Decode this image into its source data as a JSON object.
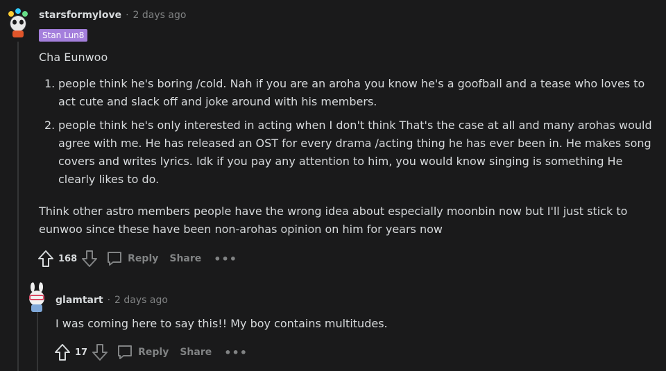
{
  "comments": [
    {
      "username": "starsformylove",
      "time": "2 days ago",
      "flair": "Stan Lun8",
      "paragraph1": "Cha Eunwoo",
      "list": [
        {
          "num": "1.",
          "text": "people think he's boring /cold. Nah if you are an aroha you know he's a goofball and a tease who loves to act cute and slack off and joke around with his members."
        },
        {
          "num": "2.",
          "text": "people think he's only interested in acting when I don't think That's the case at all and many arohas would agree with me. He has released an OST for every drama /acting thing he has ever been in. He makes song covers and writes lyrics. Idk if you pay any attention to him, you would know singing is something He clearly likes to do."
        }
      ],
      "paragraph2": "Think other astro members people have the wrong idea about especially moonbin now but I'll just stick to eunwoo since these have been non-arohas opinion on him for years now",
      "votes": "168",
      "reply_label": "Reply",
      "share_label": "Share",
      "more_label": "•••"
    },
    {
      "username": "glamtart",
      "time": "2 days ago",
      "text": "I was coming here to say this!! My boy contains multitudes.",
      "votes": "17",
      "reply_label": "Reply",
      "share_label": "Share",
      "more_label": "•••"
    }
  ],
  "meta_separator": "·",
  "colors": {
    "background": "#1a1a1b",
    "text": "#d7dadc",
    "muted": "#818384",
    "flair_bg": "#a47fdc",
    "thread_line": "#343536"
  }
}
